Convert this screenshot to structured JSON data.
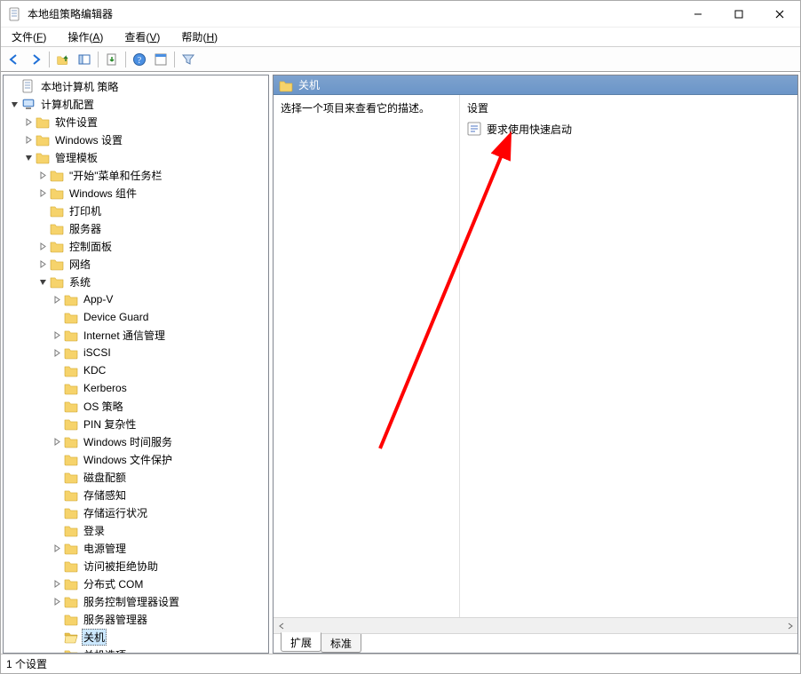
{
  "window": {
    "title": "本地组策略编辑器"
  },
  "menubar": [
    {
      "label": "文件",
      "accel": "F"
    },
    {
      "label": "操作",
      "accel": "A"
    },
    {
      "label": "查看",
      "accel": "V"
    },
    {
      "label": "帮助",
      "accel": "H"
    }
  ],
  "tree": {
    "root_label": "本地计算机 策略",
    "computer_config": "计算机配置",
    "software_settings": "软件设置",
    "windows_settings": "Windows 设置",
    "admin_templates": "管理模板",
    "start_menu_taskbar": "\"开始\"菜单和任务栏",
    "windows_components": "Windows 组件",
    "printers": "打印机",
    "server": "服务器",
    "control_panel": "控制面板",
    "network": "网络",
    "system": "系统",
    "app_v": "App-V",
    "device_guard": "Device Guard",
    "internet_comm": "Internet 通信管理",
    "iscsi": "iSCSI",
    "kdc": "KDC",
    "kerberos": "Kerberos",
    "os_policy": "OS 策略",
    "pin_complexity": "PIN 复杂性",
    "windows_time": "Windows 时间服务",
    "windows_file_protection": "Windows 文件保护",
    "disk_quota": "磁盘配额",
    "storage_sense": "存储感知",
    "storage_health": "存储运行状况",
    "logon": "登录",
    "power_management": "电源管理",
    "access_denied": "访问被拒绝协助",
    "dcom": "分布式 COM",
    "svc_control_mgr": "服务控制管理器设置",
    "server_manager": "服务器管理器",
    "shutdown": "关机",
    "shutdown_options": "关机选项"
  },
  "right": {
    "header_title": "关机",
    "description_hint": "选择一个项目来查看它的描述。",
    "settings_header": "设置",
    "items": [
      {
        "label": "要求使用快速启动"
      }
    ]
  },
  "tabs": {
    "extended": "扩展",
    "standard": "标准"
  },
  "statusbar": {
    "text": "1 个设置"
  }
}
